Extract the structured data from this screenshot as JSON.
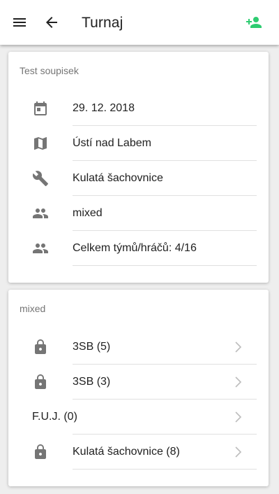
{
  "appbar": {
    "title": "Turnaj",
    "accent": "#2ecc71"
  },
  "tournament": {
    "name": "Test soupisek",
    "details": [
      {
        "icon": "calendar-icon",
        "text": "29. 12. 2018"
      },
      {
        "icon": "map-icon",
        "text": "Ústí nad Labem"
      },
      {
        "icon": "wrench-icon",
        "text": "Kulatá šachovnice"
      },
      {
        "icon": "people-icon",
        "text": "mixed"
      },
      {
        "icon": "people-icon",
        "text": "Celkem týmů/hráčů: 4/16"
      }
    ]
  },
  "group": {
    "name": "mixed",
    "teams": [
      {
        "locked": true,
        "text": "3SB (5)"
      },
      {
        "locked": true,
        "text": "3SB (3)"
      },
      {
        "locked": false,
        "text": "F.U.J. (0)"
      },
      {
        "locked": true,
        "text": "Kulatá šachovnice (8)"
      }
    ]
  }
}
